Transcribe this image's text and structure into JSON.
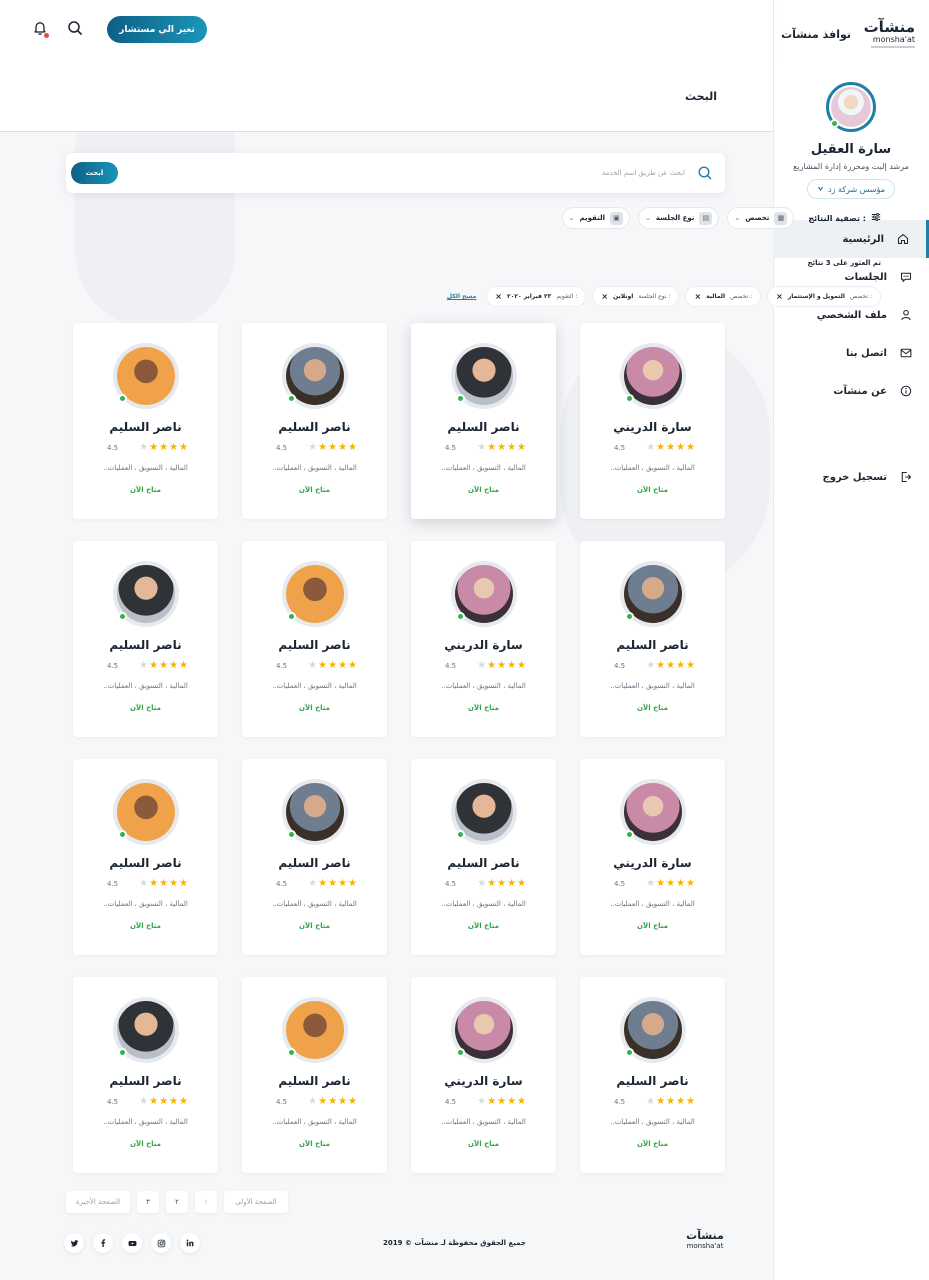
{
  "brand": {
    "logo_ar": "منشآت",
    "logo_en": "monsha'at",
    "name": "نوافذ منشآت"
  },
  "profile": {
    "name": "سارة العقيل",
    "role": "مرشد إلبت ومحررة إدارة المشاريع",
    "company": "مؤسس شركة زد"
  },
  "nav": {
    "items": [
      {
        "label": "الرئيسية",
        "icon": "home-icon"
      },
      {
        "label": "الجلسات",
        "icon": "chat-icon"
      },
      {
        "label": "ملف الشخصي",
        "icon": "user-icon"
      },
      {
        "label": "اتصل بنا",
        "icon": "mail-icon"
      },
      {
        "label": "عن منشآت",
        "icon": "info-icon"
      }
    ],
    "logout": "تسجيل خروج"
  },
  "topbar": {
    "switch_label": "تغير الي مستشار"
  },
  "page": {
    "title": "البحث"
  },
  "search": {
    "placeholder": "ابحث عن طريق اسم الخدمة",
    "button": "ابحث"
  },
  "filters": {
    "label": "تصفية النتائج :",
    "items": [
      "تخصص",
      "نوع الجلسة",
      "التقويم"
    ]
  },
  "results": {
    "count_text": "تم العثور على 3 نتائج"
  },
  "chips": {
    "items": [
      {
        "key": "تخصص :",
        "value": "التمويل و الإستثمار"
      },
      {
        "key": "تخصص :",
        "value": "المالية"
      },
      {
        "key": "نوع الجلسة :",
        "value": "اونلاين"
      },
      {
        "key": "التقويم :",
        "value": "٢٣ فبراير ٢٠٢٠"
      }
    ],
    "clear_all": "مسح الكل"
  },
  "cards": [
    {
      "name": "سارة الدريني",
      "rating": 4.5,
      "stars": 4,
      "tags": "المالية ، التسويق ، العمليات..",
      "status": "متاح الآن",
      "avatar": "d"
    },
    {
      "name": "ناصر السليم",
      "rating": 4.5,
      "stars": 4,
      "tags": "المالية ، التسويق ، العمليات..",
      "status": "متاح الآن",
      "avatar": "c"
    },
    {
      "name": "ناصر السليم",
      "rating": 4.5,
      "stars": 4,
      "tags": "المالية ، التسويق ، العمليات..",
      "status": "متاح الآن",
      "avatar": "b"
    },
    {
      "name": "ناصر السليم",
      "rating": 4.5,
      "stars": 4,
      "tags": "المالية ، التسويق ، العمليات..",
      "status": "متاح الآن",
      "avatar": "a"
    },
    {
      "name": "ناصر السليم",
      "rating": 4.5,
      "stars": 4,
      "tags": "المالية ، التسويق ، العمليات..",
      "status": "متاح الآن",
      "avatar": "b"
    },
    {
      "name": "سارة الدريني",
      "rating": 4.5,
      "stars": 4,
      "tags": "المالية ، التسويق ، العمليات..",
      "status": "متاح الآن",
      "avatar": "d"
    },
    {
      "name": "ناصر السليم",
      "rating": 4.5,
      "stars": 4,
      "tags": "المالية ، التسويق ، العمليات..",
      "status": "متاح الآن",
      "avatar": "a"
    },
    {
      "name": "ناصر السليم",
      "rating": 4.5,
      "stars": 4,
      "tags": "المالية ، التسويق ، العمليات..",
      "status": "متاح الآن",
      "avatar": "c"
    },
    {
      "name": "سارة الدريني",
      "rating": 4.5,
      "stars": 4,
      "tags": "المالية ، التسويق ، العمليات..",
      "status": "متاح الآن",
      "avatar": "d"
    },
    {
      "name": "ناصر السليم",
      "rating": 4.5,
      "stars": 4,
      "tags": "المالية ، التسويق ، العمليات..",
      "status": "متاح الآن",
      "avatar": "c"
    },
    {
      "name": "ناصر السليم",
      "rating": 4.5,
      "stars": 4,
      "tags": "المالية ، التسويق ، العمليات..",
      "status": "متاح الآن",
      "avatar": "b"
    },
    {
      "name": "ناصر السليم",
      "rating": 4.5,
      "stars": 4,
      "tags": "المالية ، التسويق ، العمليات..",
      "status": "متاح الآن",
      "avatar": "a"
    },
    {
      "name": "ناصر السليم",
      "rating": 4.5,
      "stars": 4,
      "tags": "المالية ، التسويق ، العمليات..",
      "status": "متاح الآن",
      "avatar": "b"
    },
    {
      "name": "سارة الدريني",
      "rating": 4.5,
      "stars": 4,
      "tags": "المالية ، التسويق ، العمليات..",
      "status": "متاح الآن",
      "avatar": "d"
    },
    {
      "name": "ناصر السليم",
      "rating": 4.5,
      "stars": 4,
      "tags": "المالية ، التسويق ، العمليات..",
      "status": "متاح الآن",
      "avatar": "a"
    },
    {
      "name": "ناصر السليم",
      "rating": 4.5,
      "stars": 4,
      "tags": "المالية ، التسويق ، العمليات..",
      "status": "متاح الآن",
      "avatar": "c"
    }
  ],
  "pagination": {
    "first": "الصفحة الأولى",
    "pages": [
      "١",
      "٢",
      "٣"
    ],
    "last": "الصفحة الأخيرة"
  },
  "footer": {
    "copyright": "جميع الحقوق محفوظة لـ منشآت © 2019",
    "socials": [
      "in",
      "ig",
      "yt",
      "f",
      "tw"
    ]
  }
}
